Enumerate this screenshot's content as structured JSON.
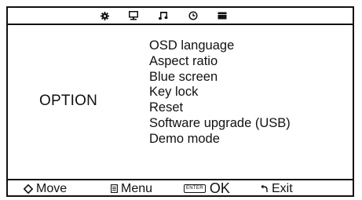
{
  "tabs": [
    {
      "icon": "gear-icon",
      "label": ""
    },
    {
      "icon": "monitor-icon",
      "label": ""
    },
    {
      "icon": "music-note-icon",
      "label": ""
    },
    {
      "icon": "clock-icon",
      "label": ""
    },
    {
      "icon": "option-block-icon",
      "label": ""
    }
  ],
  "section": {
    "title": "OPTION"
  },
  "menu": {
    "items": [
      "OSD language",
      "Aspect ratio",
      "Blue screen",
      "Key lock",
      "Reset",
      "Software upgrade (USB)",
      "Demo mode"
    ]
  },
  "hints": {
    "move": "Move",
    "menu": "Menu",
    "enter_badge": "ENTER",
    "ok": "OK",
    "exit": "Exit"
  },
  "colors": {
    "foreground": "#111111",
    "background": "#ffffff"
  }
}
